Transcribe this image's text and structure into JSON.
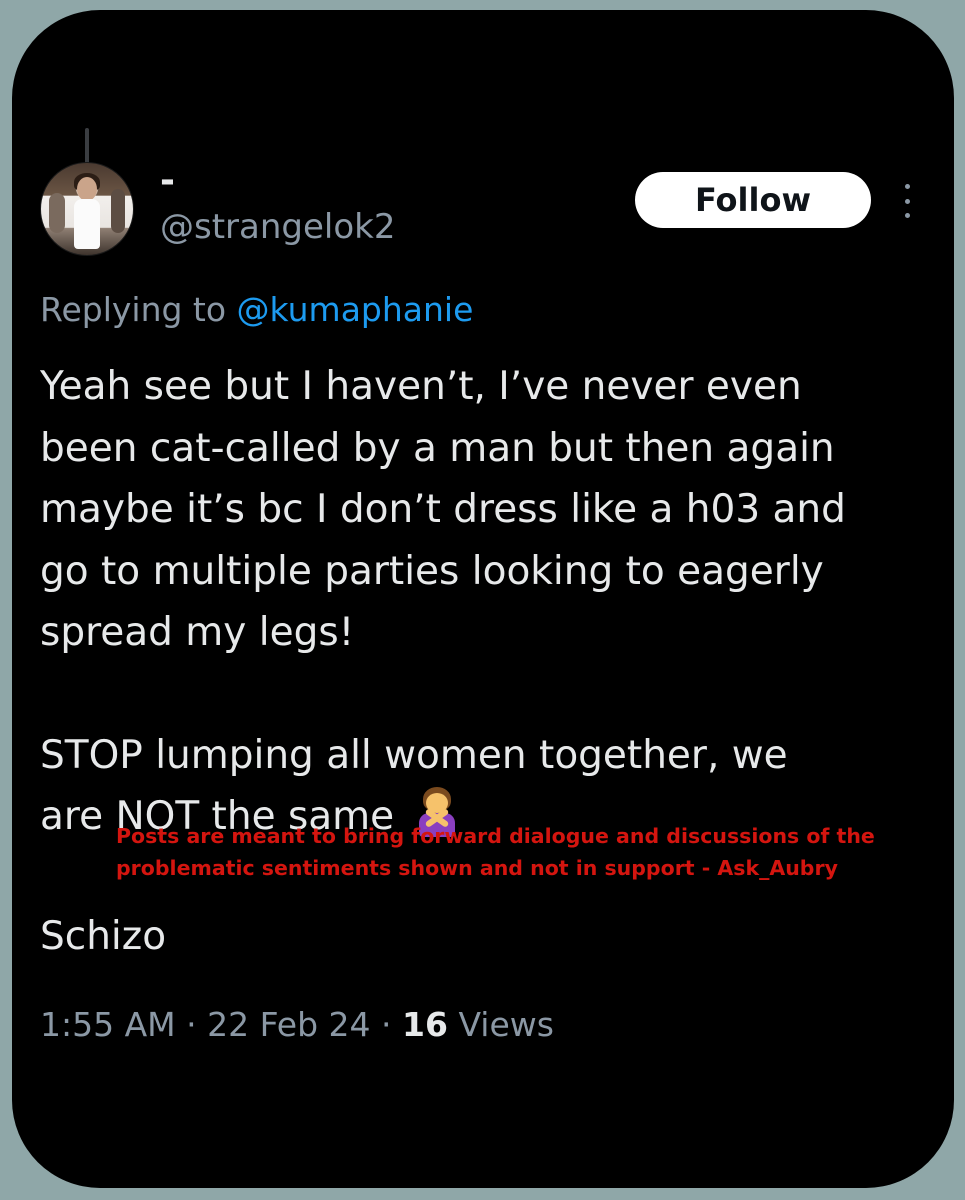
{
  "author": {
    "display_name": "-",
    "handle": "@strangelok2"
  },
  "follow_button_label": "Follow",
  "reply": {
    "prefix": "Replying to ",
    "mention": "@kumaphanie"
  },
  "tweet": {
    "lines": [
      "Yeah see but I haven’t, I’ve never even",
      "been cat-called by a man but then again",
      "maybe it’s bc I don’t dress like a h03 and",
      "go to multiple parties looking to eagerly",
      "spread my legs!",
      "STOP lumping all women together, we",
      "are NOT the same"
    ],
    "emoji": "woman-gesturing-no-icon"
  },
  "watermark": {
    "line1": "Posts are meant to bring forward dialogue and discussions of the",
    "line2": "problematic sentiments shown and not in support - Ask_Aubry"
  },
  "schizo_text": "Schizo",
  "meta": {
    "time": "1:55 AM",
    "separator": " · ",
    "date": "22 Feb 24",
    "views_count": "16",
    "views_label": " Views"
  },
  "colors": {
    "background": "#8fa7a8",
    "card": "#000000",
    "text": "#e7e9ea",
    "secondary": "#8b98a5",
    "link": "#1d9bf0",
    "watermark": "#d4150f"
  }
}
